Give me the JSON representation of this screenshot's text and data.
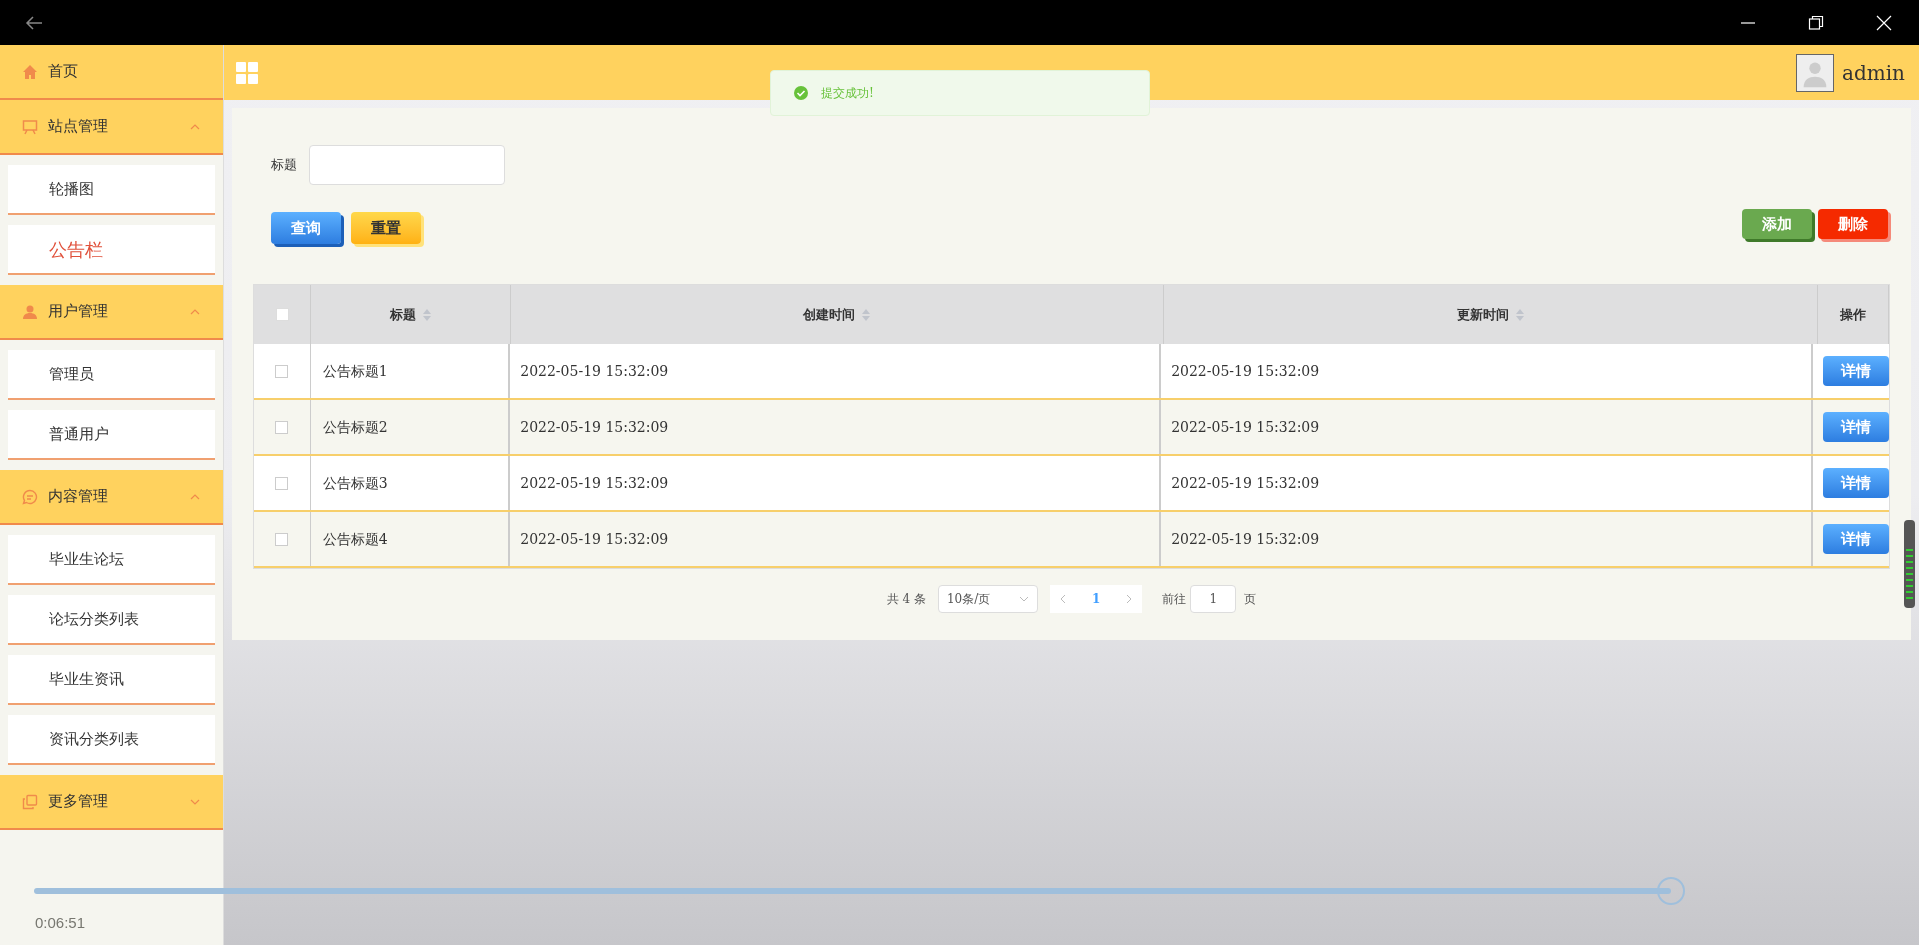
{
  "user": {
    "name": "admin"
  },
  "toast": {
    "text": "提交成功!"
  },
  "sidebar": {
    "items": [
      {
        "label": "首页",
        "kind": "home"
      },
      {
        "label": "站点管理",
        "kind": "site",
        "expanded": true,
        "children": [
          {
            "label": "轮播图",
            "selected": false
          },
          {
            "label": "公告栏",
            "selected": true
          }
        ]
      },
      {
        "label": "用户管理",
        "kind": "user",
        "expanded": true,
        "children": [
          {
            "label": "管理员",
            "selected": false
          },
          {
            "label": "普通用户",
            "selected": false
          }
        ]
      },
      {
        "label": "内容管理",
        "kind": "content",
        "expanded": true,
        "children": [
          {
            "label": "毕业生论坛",
            "selected": false
          },
          {
            "label": "论坛分类列表",
            "selected": false
          },
          {
            "label": "毕业生资讯",
            "selected": false
          },
          {
            "label": "资讯分类列表",
            "selected": false
          }
        ]
      },
      {
        "label": "更多管理",
        "kind": "more",
        "expanded": false
      }
    ]
  },
  "search": {
    "label": "标题"
  },
  "buttons": {
    "query": "查询",
    "reset": "重置",
    "add": "添加",
    "delete": "删除"
  },
  "table": {
    "select_all_checked": false,
    "columns": [
      {
        "label": "标题",
        "sortable": true
      },
      {
        "label": "创建时间",
        "sortable": true
      },
      {
        "label": "更新时间",
        "sortable": true
      },
      {
        "label": "操作",
        "sortable": false
      }
    ],
    "rows": [
      {
        "checked": false,
        "title": "公告标题1",
        "created": "2022-05-19 15:32:09",
        "updated": "2022-05-19 15:32:09",
        "action": "详情"
      },
      {
        "checked": false,
        "title": "公告标题2",
        "created": "2022-05-19 15:32:09",
        "updated": "2022-05-19 15:32:09",
        "action": "详情"
      },
      {
        "checked": false,
        "title": "公告标题3",
        "created": "2022-05-19 15:32:09",
        "updated": "2022-05-19 15:32:09",
        "action": "详情"
      },
      {
        "checked": false,
        "title": "公告标题4",
        "created": "2022-05-19 15:32:09",
        "updated": "2022-05-19 15:32:09",
        "action": "详情"
      }
    ]
  },
  "pagination": {
    "total": "共 4 条",
    "page_size": "10条/页",
    "pages": [
      {
        "label": "1",
        "selected": true
      }
    ],
    "goto": "前往",
    "goto_value": "1",
    "page_unit": "页"
  },
  "player": {
    "time": "0:06:51",
    "level": 0.98
  }
}
